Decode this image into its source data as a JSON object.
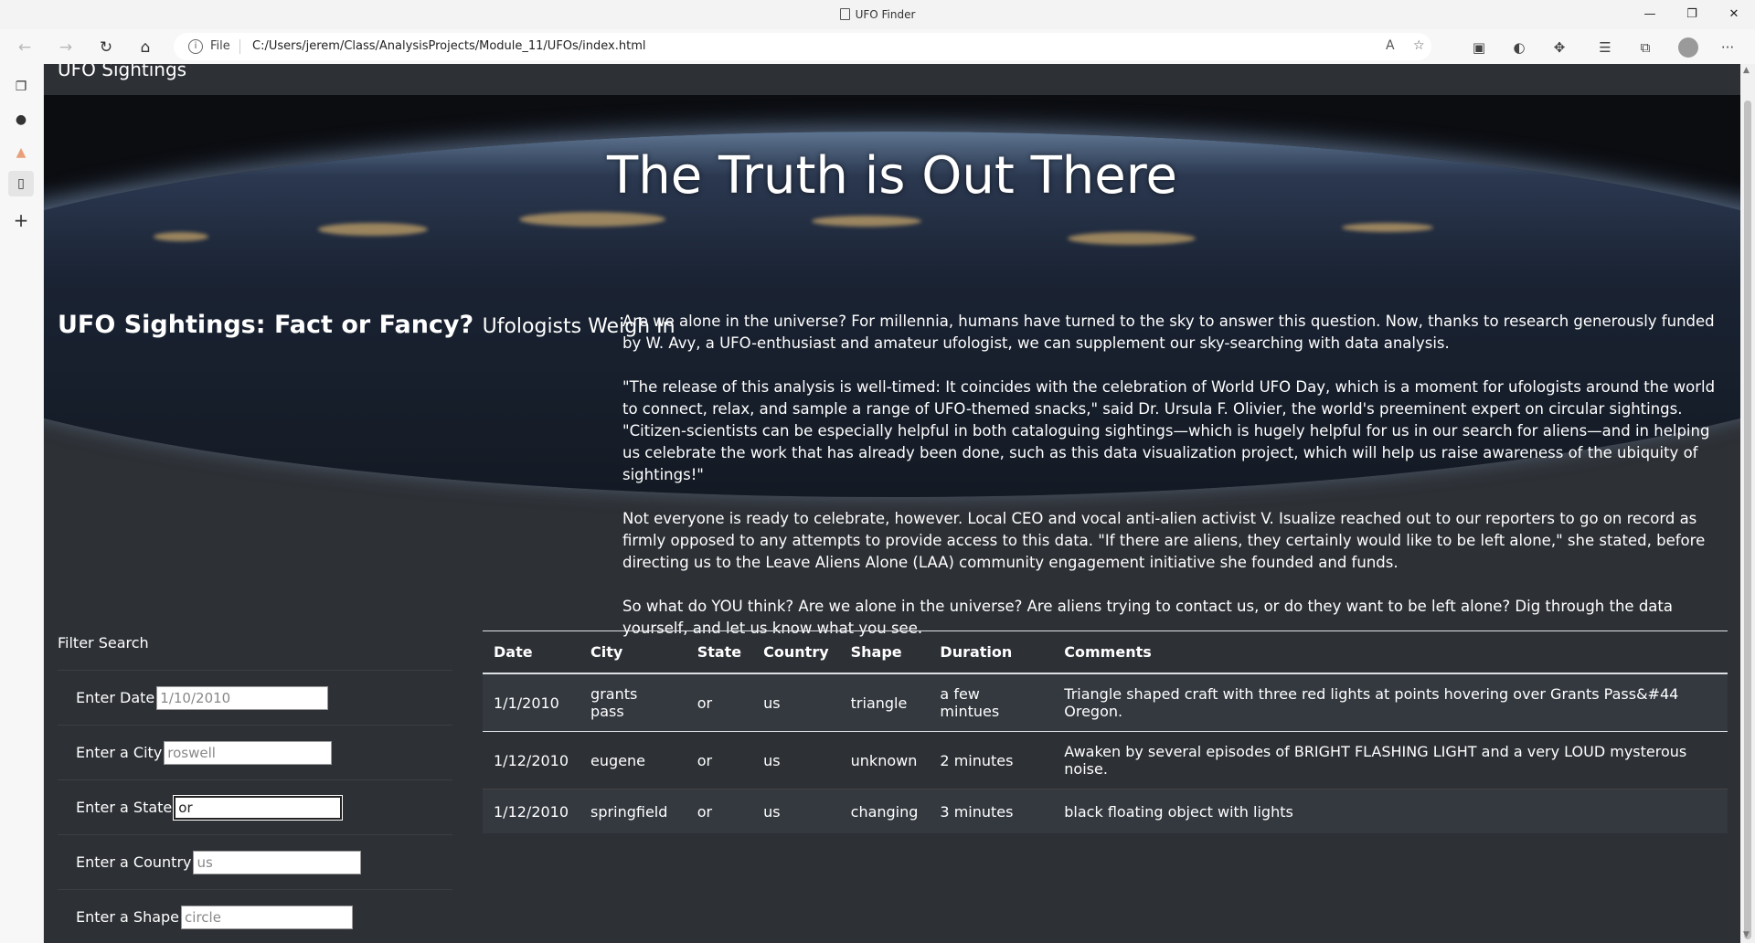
{
  "window": {
    "title": "UFO Finder",
    "minimize": "—",
    "restore": "❐",
    "close": "✕"
  },
  "browser": {
    "url_prefix": "File",
    "url": "C:/Users/jerem/Class/AnalysisProjects/Module_11/UFOs/index.html",
    "back_icon": "←",
    "forward_icon": "→",
    "refresh_icon": "↻",
    "home_icon": "⌂",
    "more_icon": "···"
  },
  "site": {
    "brand": "UFO Sightings",
    "hero_title": "The Truth is Out There",
    "heading_main": "UFO Sightings: Fact or Fancy?",
    "heading_sub": "Ufologists Weigh In",
    "paragraphs": [
      "Are we alone in the universe? For millennia, humans have turned to the sky to answer this question. Now, thanks to research generously funded by W. Avy, a UFO-enthusiast and amateur ufologist, we can supplement our sky-searching with data analysis.",
      "\"The release of this analysis is well-timed: It coincides with the celebration of World UFO Day, which is a moment for ufologists around the world to connect, relax, and sample a range of UFO-themed snacks,\" said Dr. Ursula F. Olivier, the world's preeminent expert on circular sightings. \"Citizen-scientists can be especially helpful in both cataloguing sightings—which is hugely helpful for us in our search for aliens—and in helping us celebrate the work that has already been done, such as this data visualization project, which will help us raise awareness of the ubiquity of sightings!\"",
      "Not everyone is ready to celebrate, however. Local CEO and vocal anti-alien activist V. Isualize reached out to our reporters to go on record as firmly opposed to any attempts to provide access to this data. \"If there are aliens, they certainly would like to be left alone,\" she stated, before directing us to the Leave Aliens Alone (LAA) community engagement initiative she founded and funds.",
      "So what do YOU think? Are we alone in the universe? Are aliens trying to contact us, or do they want to be left alone? Dig through the data yourself, and let us know what you see."
    ]
  },
  "filters": {
    "title": "Filter Search",
    "date": {
      "label": "Enter Date",
      "placeholder": "1/10/2010",
      "value": ""
    },
    "city": {
      "label": "Enter a City",
      "placeholder": "roswell",
      "value": ""
    },
    "state": {
      "label": "Enter a State",
      "placeholder": "",
      "value": "or"
    },
    "country": {
      "label": "Enter a Country",
      "placeholder": "us",
      "value": ""
    },
    "shape": {
      "label": "Enter a Shape",
      "placeholder": "circle",
      "value": ""
    }
  },
  "table": {
    "headers": [
      "Date",
      "City",
      "State",
      "Country",
      "Shape",
      "Duration",
      "Comments"
    ],
    "rows": [
      [
        "1/1/2010",
        "grants pass",
        "or",
        "us",
        "triangle",
        "a few mintues",
        "Triangle shaped craft with three red lights at points hovering over Grants Pass&#44 Oregon."
      ],
      [
        "1/12/2010",
        "eugene",
        "or",
        "us",
        "unknown",
        "2 minutes",
        "Awaken by several episodes of BRIGHT FLASHING LIGHT and a very LOUD mysterous noise."
      ],
      [
        "1/12/2010",
        "springfield",
        "or",
        "us",
        "changing",
        "3 minutes",
        "black floating object with lights"
      ]
    ]
  }
}
